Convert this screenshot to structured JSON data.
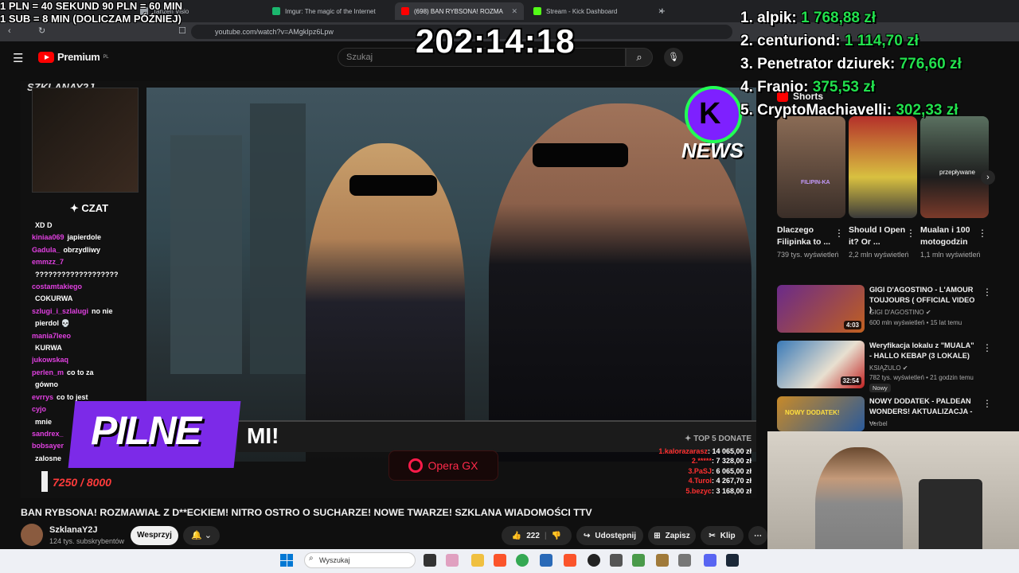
{
  "overlay": {
    "donate_line1": "1 PLN = 40 SEKUND 90 PLN = 60 MIN",
    "donate_line2": "1 SUB = 8 MIN (DOLICZAM PÓŹNIEJ)",
    "timer": "202:14:18",
    "top_donors": [
      {
        "rank_name": "1. alpik:",
        "amount": "1 768,88 zł"
      },
      {
        "rank_name": "2. centuriond:",
        "amount": "1 114,70 zł"
      },
      {
        "rank_name": "3. Penetrator dziurek:",
        "amount": "776,60 zł"
      },
      {
        "rank_name": "4. Franio:",
        "amount": "375,53 zł"
      },
      {
        "rank_name": "5. CryptoMachiavelli:",
        "amount": "302,33 zł"
      }
    ]
  },
  "browser": {
    "tabs": [
      {
        "label": "Tanzen Visio",
        "color": "#9aa0a6"
      },
      {
        "label": "Imgur: The magic of the Internet",
        "color": "#1bb76e"
      },
      {
        "label": "(698) BAN RYBSONA! ROZMA",
        "color": "#ff0000"
      },
      {
        "label": "Stream - Kick Dashboard",
        "color": "#53fc18"
      }
    ],
    "url": "youtube.com/watch?v=AMgkIpz6Lpw",
    "new_tab": "+"
  },
  "youtube": {
    "logo_text": "Premium",
    "logo_sup": "PL",
    "search_placeholder": "Szukaj",
    "search_icon": "search-icon",
    "mic_icon": "mic-icon"
  },
  "video": {
    "chat_header": "✦ CZAT",
    "chat_messages": [
      {
        "user": "",
        "text": "XD D"
      },
      {
        "user": "kiniaa069",
        "text": "japierdole"
      },
      {
        "user": "Gadula_",
        "text": "obrzydliwy"
      },
      {
        "user": "emmzz_7",
        "text": ""
      },
      {
        "user": "",
        "text": "???????????????????"
      },
      {
        "user": "costamtakiego",
        "text": ""
      },
      {
        "user": "",
        "text": "COKURWA"
      },
      {
        "user": "szlugi_i_szlalugi",
        "text": "no nie"
      },
      {
        "user": "",
        "text": "pierdol 💀"
      },
      {
        "user": "mania7leeo",
        "text": ""
      },
      {
        "user": "",
        "text": "KURWA"
      },
      {
        "user": "jukowskaq",
        "text": ""
      },
      {
        "user": "perlen_m",
        "text": "co to za"
      },
      {
        "user": "",
        "text": "gówno"
      },
      {
        "user": "evrrys",
        "text": "co to jest"
      },
      {
        "user": "cyjo",
        "text": ""
      },
      {
        "user": "",
        "text": "mnie"
      },
      {
        "user": "sandrex_",
        "text": ""
      },
      {
        "user": "bobsayer",
        "text": ""
      },
      {
        "user": "",
        "text": "zalosne"
      }
    ],
    "pilne": "PILNE",
    "ticker": "MI!",
    "goal": "7250 / 8000",
    "opera": "Opera GX",
    "top5_header": "✦ TOP 5 DONATE",
    "top5": [
      {
        "user": "1.kalorazarasz",
        "amount": ": 14 065,00 zł"
      },
      {
        "user": "2.*****",
        "amount": ": 7 328,00 zł"
      },
      {
        "user": "3.PaSJ",
        "amount": ": 6 065,00 zł"
      },
      {
        "user": "4.Turoi",
        "amount": ": 4 267,70 zł"
      },
      {
        "user": "5.bezyc",
        "amount": ": 3 168,00 zł"
      }
    ],
    "badge_k": "K",
    "badge_news": "NEWS",
    "watermark": "SZKLANAY2J",
    "title": "BAN RYBSONA! ROZMAWIAŁ Z D**ECKIEM! NITRO OSTRO O SUCHARZE! NOWE TWARZE! SZKLANA WIADOMOŚCI TTV"
  },
  "channel": {
    "name": "SzklanaY2J",
    "subs": "124 tys. subskrybentów",
    "subscribe": "Wesprzyj",
    "likes": "222",
    "share": "Udostępnij",
    "save": "Zapisz",
    "clip": "Klip",
    "more": "⋯"
  },
  "sidebar": {
    "shorts_label": "Shorts",
    "shorts": [
      {
        "title": "Dlaczego Filipinka to ...",
        "views": "739 tys. wyświetleń",
        "color": "#8a6b55"
      },
      {
        "title": "Should I Open it? Or ...",
        "views": "2,2 mln wyświetleń",
        "color": "#b4302a"
      },
      {
        "title": "Mualan i 100 motogodzin",
        "views": "1,1 mln wyświetleń",
        "color": "#5a7060"
      }
    ],
    "videos": [
      {
        "title": "GIGI D'AGOSTINO - L'AMOUR TOUJOURS ( OFFICIAL VIDEO )",
        "channel": "GIGI D'AGOSTINO ✔",
        "meta": "600 mln wyświetleń • 15 lat temu",
        "duration": "4:03",
        "color": "#6a2a8a"
      },
      {
        "title": "Weryfikacja lokalu z \"MUALA\" - HALLO KEBAP (3 LOKALE)",
        "channel": "KSIĄŻULO ✔",
        "meta": "782 tys. wyświetleń • 21 godzin temu",
        "duration": "32:54",
        "color": "#3a7ab8"
      },
      {
        "title": "NOWY DODATEK - PALDEAN WONDERS! AKTUALIZACJA - ...",
        "channel": "Verbel",
        "meta": "",
        "duration": "",
        "color": "#c88a28"
      }
    ],
    "new_badge": "Nowy",
    "thumb_labels": [
      "FILIPIN-KA",
      "przepływane",
      "NOWY DODATEK!"
    ]
  },
  "taskbar": {
    "search": "Wyszukaj"
  }
}
